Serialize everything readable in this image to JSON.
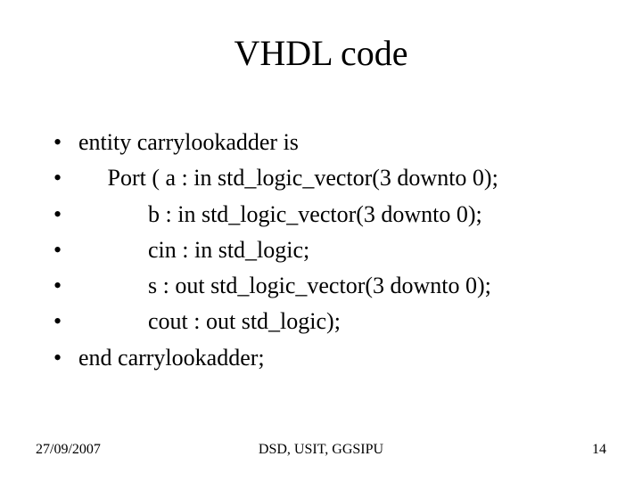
{
  "title": "VHDL code",
  "bullets": [
    "entity carrylookadder is",
    "     Port ( a : in std_logic_vector(3 downto 0);",
    "            b : in std_logic_vector(3 downto 0);",
    "            cin : in std_logic;",
    "            s : out std_logic_vector(3 downto 0);",
    "            cout : out std_logic);",
    "end carrylookadder;"
  ],
  "footer": {
    "date": "27/09/2007",
    "center": "DSD, USIT, GGSIPU",
    "page": "14"
  }
}
